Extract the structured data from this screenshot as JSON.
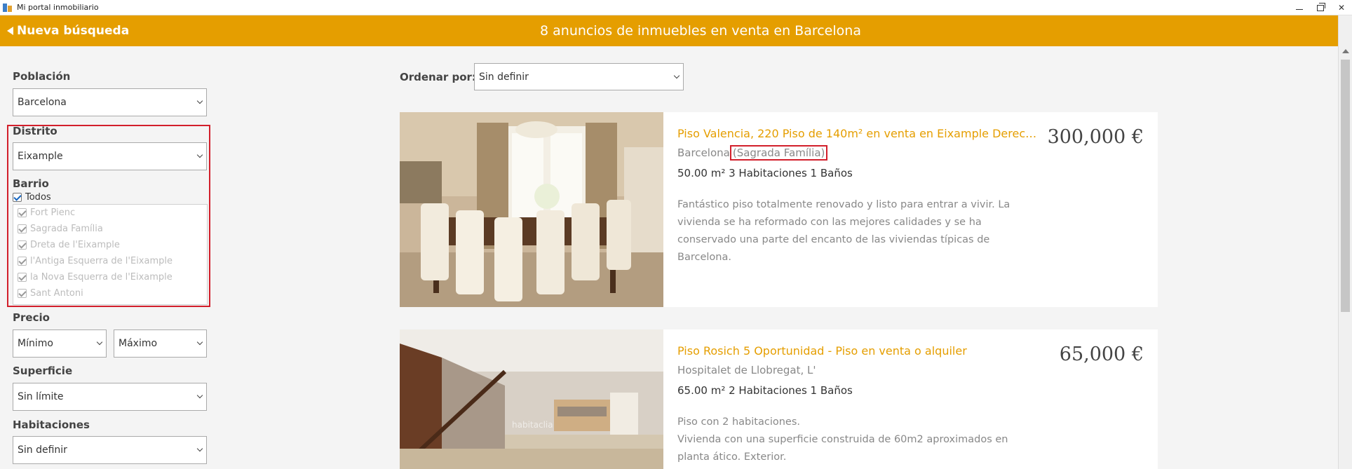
{
  "window": {
    "title": "Mi portal inmobiliario"
  },
  "header": {
    "back_label": "Nueva búsqueda",
    "title": "8 anuncios de inmuebles en venta en Barcelona"
  },
  "filters": {
    "poblacion": {
      "label": "Población",
      "value": "Barcelona"
    },
    "distrito": {
      "label": "Distrito",
      "value": "Eixample"
    },
    "barrio": {
      "label": "Barrio",
      "all_label": "Todos",
      "items": [
        "Fort Pienc",
        "Sagrada Família",
        "Dreta de l'Eixample",
        "l'Antiga Esquerra de l'Eixample",
        "la Nova Esquerra de l'Eixample",
        "Sant Antoni"
      ]
    },
    "precio": {
      "label": "Precio",
      "min": "Mínimo",
      "max": "Máximo"
    },
    "superficie": {
      "label": "Superficie",
      "value": "Sin límite"
    },
    "habitaciones": {
      "label": "Habitaciones",
      "value": "Sin definir"
    }
  },
  "sort": {
    "label": "Ordenar por:",
    "value": "Sin definir"
  },
  "listings": [
    {
      "title": "Piso Valencia, 220 Piso de 140m² en venta en Eixample Derech…",
      "city": "Barcelona",
      "neighborhood": "(Sagrada Família)",
      "specs": "50.00 m² 3 Habitaciones 1 Baños",
      "description": "Fantástico piso totalmente renovado y listo para entrar a vivir. La vivienda se ha reformado con las mejores calidades y se ha conservado una parte del encanto de las viviendas típicas de Barcelona.",
      "price": "300,000 €"
    },
    {
      "title": "Piso Rosich 5 Oportunidad - Piso en venta o alquiler",
      "city": "Hospitalet de Llobregat, L'",
      "specs": "65.00 m² 2 Habitaciones 1 Baños",
      "description_line1": "Piso con 2 habitaciones.",
      "description_line2": "Vivienda con una superficie construida de 60m2 aproximados en planta ático. Exterior.",
      "price": "65,000 €",
      "watermark": "habitaclia"
    }
  ],
  "colors": {
    "accent": "#e59e00",
    "highlight": "#d21f2b"
  }
}
